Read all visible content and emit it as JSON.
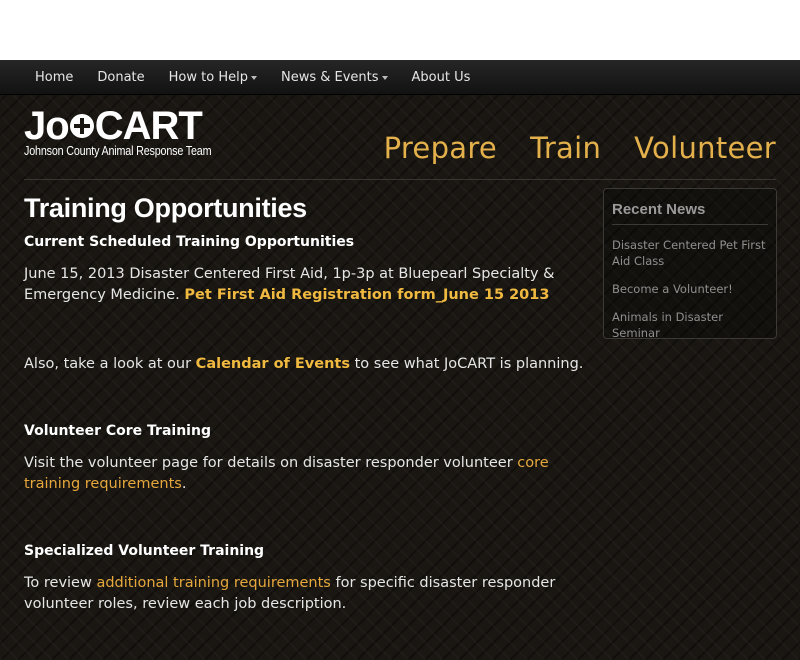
{
  "topnav": {
    "items": [
      {
        "label": "Home",
        "dropdown": false
      },
      {
        "label": "Donate",
        "dropdown": false
      },
      {
        "label": "How to Help",
        "dropdown": true
      },
      {
        "label": "News & Events",
        "dropdown": true
      },
      {
        "label": "About Us",
        "dropdown": false
      }
    ]
  },
  "logo": {
    "letters_left": "Jo",
    "letters_right": "CART",
    "subtitle": "Johnson County Animal Response Team"
  },
  "mainnav": {
    "prepare": "Prepare",
    "train": "Train",
    "volunteer": "Volunteer"
  },
  "content": {
    "title": "Training Opportunities",
    "sections": {
      "current": {
        "heading": "Current Scheduled Training Opportunities",
        "text": "June 15, 2013 Disaster Centered First Aid, 1p-3p at Bluepearl Specialty & Emergency Medicine.",
        "link": "Pet First Aid Registration form_June 15 2013"
      },
      "calendar": {
        "before": "Also, take a look at our ",
        "link": "Calendar of Events",
        "after": " to see what JoCART is planning."
      },
      "core": {
        "heading": "Volunteer Core Training",
        "before": "Visit the volunteer page for details on disaster responder volunteer ",
        "link": "core training requirements",
        "after": "."
      },
      "specialized": {
        "heading": "Specialized Volunteer Training",
        "before": "To review ",
        "link": "additional training requirements",
        "after": " for specific disaster responder volunteer roles, review each job description."
      }
    }
  },
  "sidebar": {
    "title": "Recent News",
    "items": [
      "Disaster Centered Pet First Aid Class",
      "Become a Volunteer!",
      "Animals in Disaster Seminar"
    ]
  },
  "colors": {
    "accent": "#e3b04b",
    "background": "#1a1713"
  }
}
